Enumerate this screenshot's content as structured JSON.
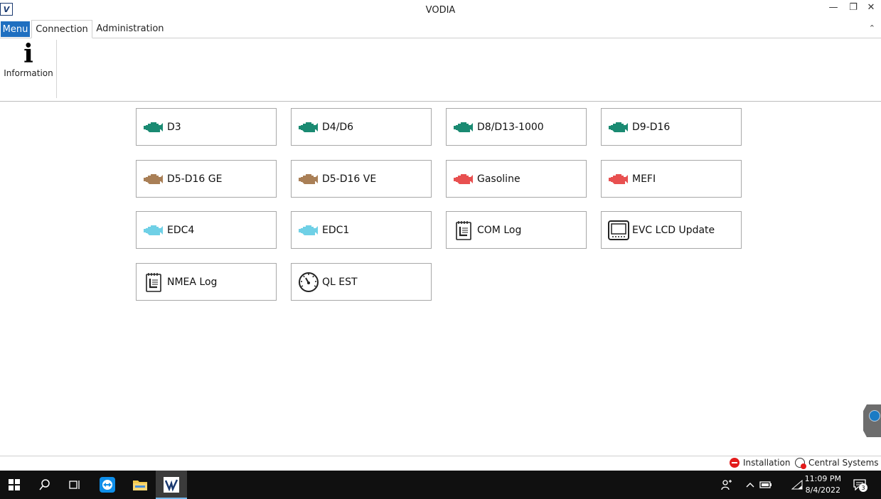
{
  "window": {
    "title": "VODIA",
    "logo_text": "V",
    "minimize": "—",
    "restore": "❐",
    "close": "✕"
  },
  "ribbon": {
    "menu_label": "Menu",
    "tabs": [
      {
        "label": "Connection",
        "active": true
      },
      {
        "label": "Administration",
        "active": false
      }
    ],
    "collapse": "⌃",
    "buttons": [
      {
        "label": "Information",
        "icon": "info-icon",
        "glyph": "i"
      }
    ]
  },
  "tiles": [
    {
      "label": "D3",
      "icon": "engine-icon",
      "color": "#1a8a72"
    },
    {
      "label": "D4/D6",
      "icon": "engine-icon",
      "color": "#1a8a72"
    },
    {
      "label": "D8/D13-1000",
      "icon": "engine-icon",
      "color": "#1a8a72"
    },
    {
      "label": "D9-D16",
      "icon": "engine-icon",
      "color": "#1a8a72"
    },
    {
      "label": "D5-D16 GE",
      "icon": "engine-icon",
      "color": "#a97f56"
    },
    {
      "label": "D5-D16 VE",
      "icon": "engine-icon",
      "color": "#a97f56"
    },
    {
      "label": "Gasoline",
      "icon": "engine-icon",
      "color": "#e85050"
    },
    {
      "label": "MEFI",
      "icon": "engine-icon",
      "color": "#e85050"
    },
    {
      "label": "EDC4",
      "icon": "engine-icon",
      "color": "#6fd0e6"
    },
    {
      "label": "EDC1",
      "icon": "engine-icon",
      "color": "#6fd0e6"
    },
    {
      "label": "COM Log",
      "icon": "log-icon",
      "color": "#222222"
    },
    {
      "label": "EVC LCD Update",
      "icon": "display-icon",
      "color": "#222222"
    },
    {
      "label": "NMEA Log",
      "icon": "log-icon",
      "color": "#222222"
    },
    {
      "label": "QL EST",
      "icon": "gauge-icon",
      "color": "#222222"
    }
  ],
  "status": {
    "installation": "Installation",
    "central_systems": "Central Systems",
    "installation_color": "#e31b1b"
  },
  "taskbar": {
    "time": "11:09 PM",
    "date": "8/4/2022",
    "notifications": "3"
  }
}
